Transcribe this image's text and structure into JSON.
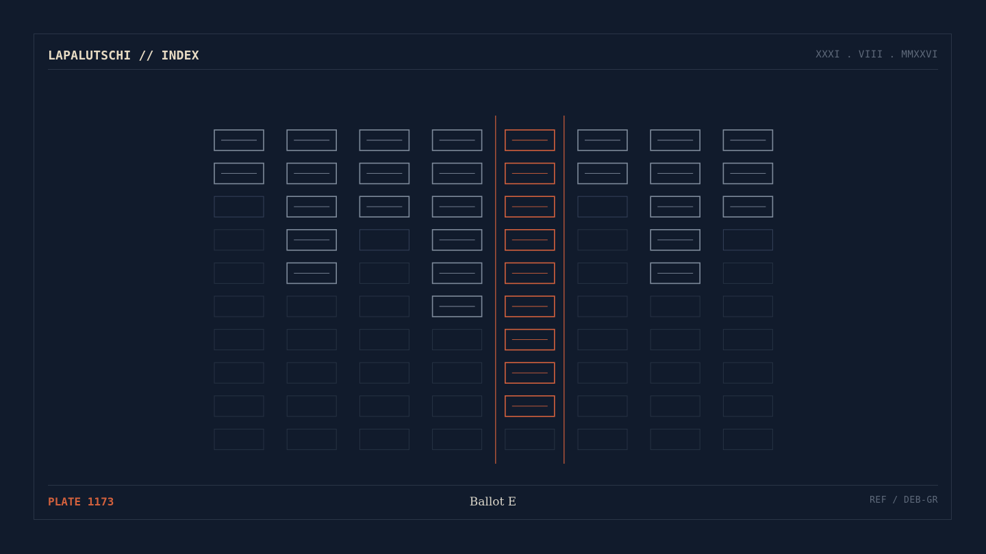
{
  "header": {
    "title": "LAPALUTSCHI // INDEX",
    "date": "XXXI . VIII . MMXXVI"
  },
  "footer": {
    "plate": "PLATE 1173",
    "caption": "Ballot E",
    "ref": "REF / DEB-GR"
  },
  "grid": {
    "rows": 10,
    "highlighted_column": 4,
    "columns": [
      {
        "filled": 2
      },
      {
        "filled": 5
      },
      {
        "filled": 3
      },
      {
        "filled": 6
      },
      {
        "filled": 9
      },
      {
        "filled": 2
      },
      {
        "filled": 5
      },
      {
        "filled": 3
      }
    ],
    "partial_cells": [
      {
        "column": 0,
        "row": 2
      },
      {
        "column": 2,
        "row": 3
      },
      {
        "column": 5,
        "row": 2
      },
      {
        "column": 7,
        "row": 3
      }
    ]
  },
  "colors": {
    "background": "#111b2c",
    "filled": "#7e8a9b",
    "empty": "#273244",
    "partial": "#35425a",
    "accent": "#d3613d"
  }
}
